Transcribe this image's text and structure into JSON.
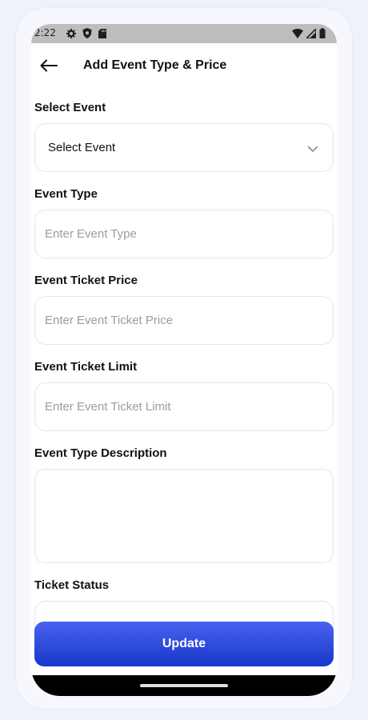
{
  "status_bar": {
    "time": "2:22",
    "left_icons": [
      "gear-icon",
      "shield-icon",
      "sd-card-icon"
    ],
    "right_icons": [
      "wifi-icon",
      "signal-icon",
      "battery-icon"
    ]
  },
  "header": {
    "back_icon": "arrow-left-icon",
    "title": "Add Event Type & Price"
  },
  "form": {
    "select_event": {
      "label": "Select Event",
      "value": "Select Event"
    },
    "event_type": {
      "label": "Event Type",
      "value": "",
      "placeholder": "Enter Event Type"
    },
    "ticket_price": {
      "label": "Event Ticket Price",
      "value": "",
      "placeholder": "Enter Event Ticket Price"
    },
    "ticket_limit": {
      "label": "Event Ticket Limit",
      "value": "",
      "placeholder": "Enter Event Ticket Limit"
    },
    "description": {
      "label": "Event Type Description",
      "value": ""
    },
    "ticket_status": {
      "label": "Ticket Status"
    }
  },
  "update_button": {
    "label": "Update"
  },
  "colors": {
    "primary_gradient_top": "#4a62f0",
    "primary_gradient_bottom": "#1637c9",
    "status_bar": "#bdbdbd",
    "background": "#eef2fb"
  }
}
